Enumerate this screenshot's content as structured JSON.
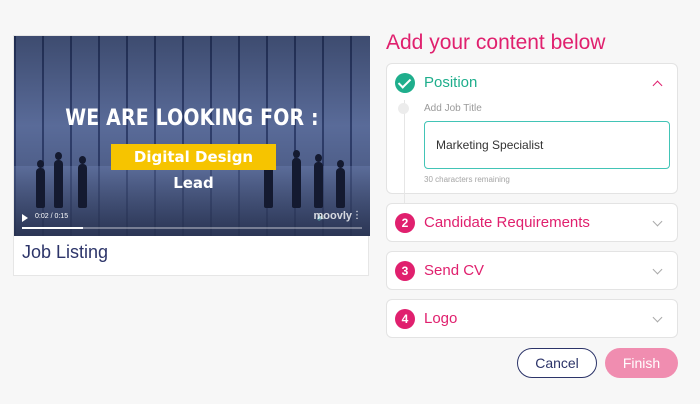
{
  "preview": {
    "headline": "WE ARE LOOKING FOR :",
    "role": "Digital Design Lead",
    "time": "0:02 / 0:15",
    "progress": 0.18,
    "brand": "moovly",
    "title": "Job Listing"
  },
  "panel": {
    "title": "Add your content below",
    "steps": [
      {
        "label": "Position",
        "status": "completed",
        "expanded": true
      },
      {
        "number": "2",
        "label": "Candidate Requirements"
      },
      {
        "number": "3",
        "label": "Send CV"
      },
      {
        "number": "4",
        "label": "Logo"
      }
    ],
    "position": {
      "field_label": "Add Job Title",
      "value": "Marketing Specialist",
      "chars_remaining": "30 characters remaining"
    }
  },
  "actions": {
    "cancel": "Cancel",
    "finish": "Finish"
  },
  "colors": {
    "accent": "#e0206e",
    "success": "#1fae8c",
    "navy": "#2c3469",
    "finish_disabled": "#f08db0",
    "highlight": "#f6c400"
  }
}
